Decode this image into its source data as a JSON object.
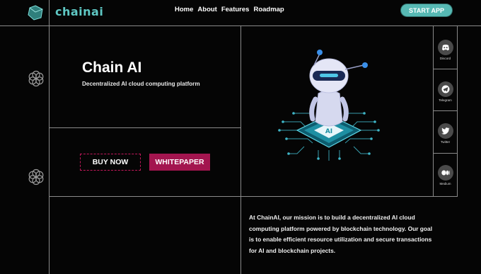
{
  "brand": {
    "name": "chainai"
  },
  "nav": {
    "items": [
      "Home",
      "About",
      "Features",
      "Roadmap"
    ]
  },
  "header": {
    "start_app_label": "START APP"
  },
  "hero": {
    "title": "Chain AI",
    "subtitle": "Decentralized AI cloud computing platform",
    "buy_label": "BUY NOW",
    "whitepaper_label": "WHITEPAPER"
  },
  "robot": {
    "chip_label": "AI"
  },
  "mission": {
    "text": "At ChainAI, our mission is to build a decentralized AI cloud computing platform powered by blockchain technology. Our goal is to enable efficient resource utilization and secure transactions for AI and blockchain projects."
  },
  "social": {
    "items": [
      {
        "label": "Discord",
        "icon": "discord-icon"
      },
      {
        "label": "Telegram",
        "icon": "telegram-icon"
      },
      {
        "label": "Twitter",
        "icon": "twitter-icon"
      },
      {
        "label": "Medium",
        "icon": "medium-icon"
      }
    ]
  },
  "colors": {
    "accent_teal": "#57b9b4",
    "brand_teal": "#5fc8c4",
    "accent_magenta": "#a3154f",
    "background": "#050505"
  }
}
